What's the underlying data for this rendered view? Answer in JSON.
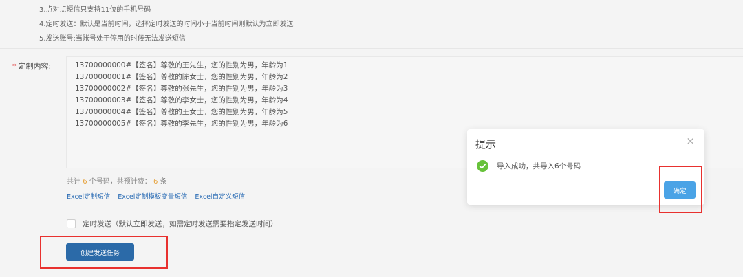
{
  "notes": [
    "3.点对点短信只支持11位的手机号码",
    "4.定时发送：默认是当前时间，选择定时发送的时间小于当前时间则默认为立即发送",
    "5.发送账号:当账号处于停用的时候无法发送短信"
  ],
  "form": {
    "required_mark": "*",
    "content_label": "定制内容:",
    "content_lines": [
      "13700000000#【签名】尊敬的王先生，您的性别为男，年龄为1",
      "13700000001#【签名】尊敬的陈女士，您的性别为男，年龄为2",
      "13700000002#【签名】尊敬的张先生，您的性别为男，年龄为3",
      "13700000003#【签名】尊敬的李女士，您的性别为男，年龄为4",
      "13700000004#【签名】尊敬的王女士，您的性别为男，年龄为5",
      "13700000005#【签名】尊敬的李先生，您的性别为男，年龄为6"
    ],
    "count": {
      "prefix": "共计",
      "numbers": "6",
      "middle": "个号码，共预计费：",
      "fee": "6",
      "suffix": "条"
    },
    "links": [
      "Excel定制短信",
      "Excel定制模板变量短信",
      "Excel自定义短信"
    ],
    "schedule_label": "定时发送（默认立即发送，如需定时发送需要指定发送时间）",
    "create_button": "创建发送任务"
  },
  "dialog": {
    "title": "提示",
    "close_glyph": "×",
    "message": "导入成功，共导入6个号码",
    "ok_button": "确定"
  },
  "colors": {
    "primary_button": "#2b6aa8",
    "dialog_button": "#4aa3e6",
    "success": "#67c23a",
    "highlight": "#e8312f",
    "count_number": "#e6a23c"
  }
}
